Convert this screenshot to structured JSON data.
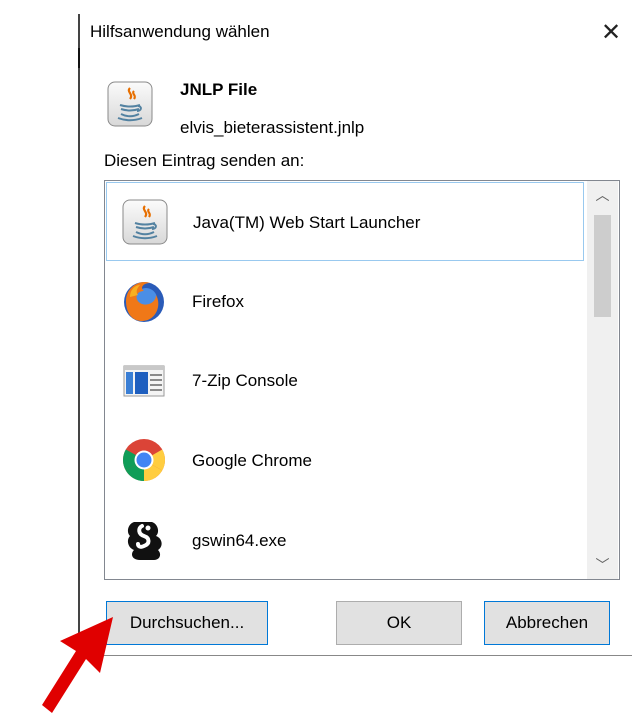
{
  "dialog": {
    "title": "Hilfsanwendung wählen",
    "close_icon": "close-icon"
  },
  "file": {
    "type": "JNLP File",
    "name": "elvis_bieterassistent.jnlp",
    "icon": "java-icon"
  },
  "send_label": "Diesen Eintrag senden an:",
  "apps": [
    {
      "label": "Java(TM) Web Start Launcher",
      "icon": "java-icon",
      "selected": true
    },
    {
      "label": "Firefox",
      "icon": "firefox-icon",
      "selected": false
    },
    {
      "label": "7-Zip Console",
      "icon": "7zip-console-icon",
      "selected": false
    },
    {
      "label": "Google Chrome",
      "icon": "chrome-icon",
      "selected": false
    },
    {
      "label": "gswin64.exe",
      "icon": "ghostscript-icon",
      "selected": false
    }
  ],
  "buttons": {
    "browse": "Durchsuchen...",
    "ok": "OK",
    "cancel": "Abbrechen"
  },
  "colors": {
    "focus_border": "#0078d7",
    "selection_border": "#99c9ef",
    "button_bg": "#e1e1e1",
    "arrow": "#e00000"
  }
}
